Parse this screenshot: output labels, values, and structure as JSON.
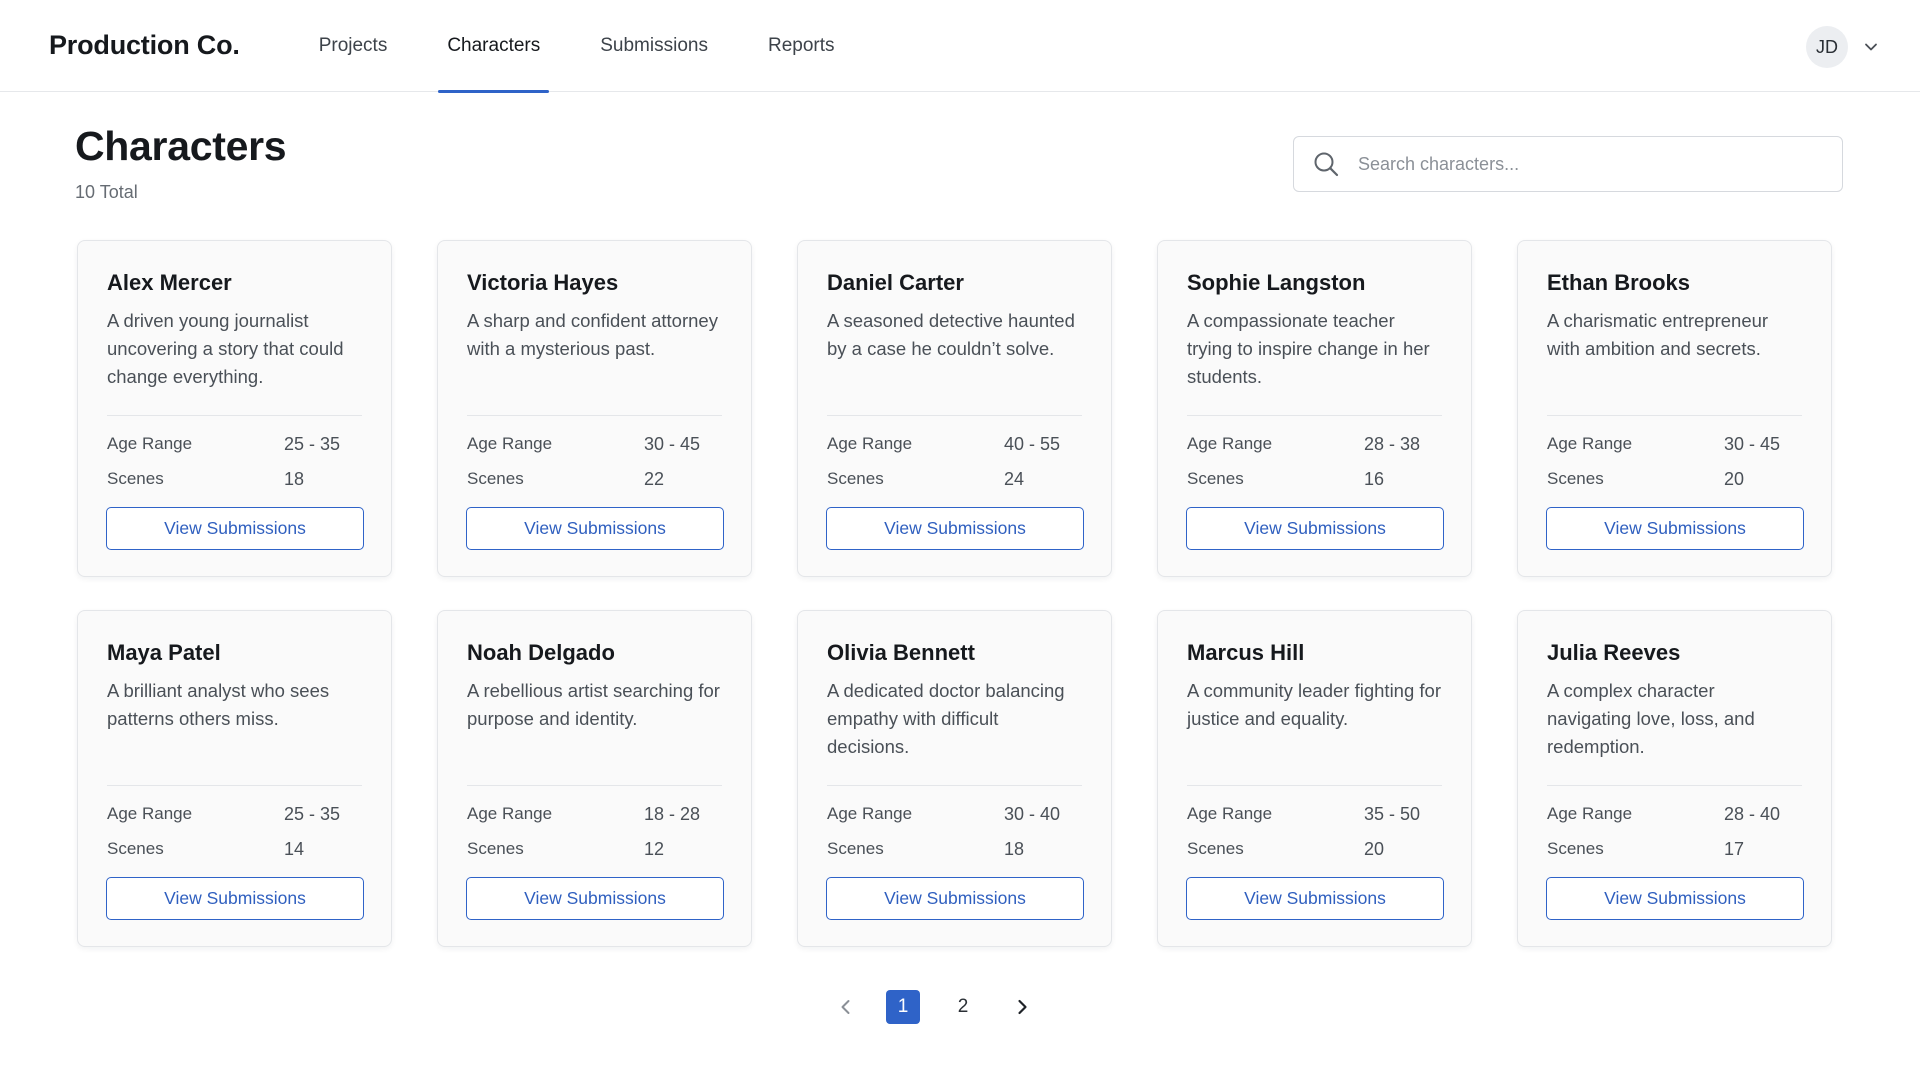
{
  "app": {
    "brand": "Production Co."
  },
  "nav": {
    "items": [
      {
        "label": "Projects",
        "active": false
      },
      {
        "label": "Characters",
        "active": true
      },
      {
        "label": "Submissions",
        "active": false
      },
      {
        "label": "Reports",
        "active": false
      }
    ]
  },
  "user": {
    "initials": "JD"
  },
  "page": {
    "title": "Characters",
    "count": "10 Total"
  },
  "search": {
    "placeholder": "Search characters...",
    "value": ""
  },
  "labels": {
    "age_range": "Age Range",
    "scenes": "Scenes",
    "view_button": "View Submissions"
  },
  "characters": [
    {
      "name": "Alex Mercer",
      "description": "A driven young journalist uncovering a story that could change everything.",
      "age_range": "25 - 35",
      "scenes": "18"
    },
    {
      "name": "Victoria Hayes",
      "description": "A sharp and confident attorney with a mysterious past.",
      "age_range": "30 - 45",
      "scenes": "22"
    },
    {
      "name": "Daniel Carter",
      "description": "A seasoned detective haunted by a case he couldn’t solve.",
      "age_range": "40 - 55",
      "scenes": "24"
    },
    {
      "name": "Sophie Langston",
      "description": "A compassionate teacher trying to inspire change in her students.",
      "age_range": "28 - 38",
      "scenes": "16"
    },
    {
      "name": "Ethan Brooks",
      "description": "A charismatic entrepreneur with ambition and secrets.",
      "age_range": "30 - 45",
      "scenes": "20"
    },
    {
      "name": "Maya Patel",
      "description": "A brilliant analyst who sees patterns others miss.",
      "age_range": "25 - 35",
      "scenes": "14"
    },
    {
      "name": "Noah Delgado",
      "description": "A rebellious artist searching for purpose and identity.",
      "age_range": "18 - 28",
      "scenes": "12"
    },
    {
      "name": "Olivia Bennett",
      "description": "A dedicated doctor balancing empathy with difficult decisions.",
      "age_range": "30 - 40",
      "scenes": "18"
    },
    {
      "name": "Marcus Hill",
      "description": "A community leader fighting for justice and equality.",
      "age_range": "35 - 50",
      "scenes": "20"
    },
    {
      "name": "Julia Reeves",
      "description": "A complex character navigating love, loss, and redemption.",
      "age_range": "28 - 40",
      "scenes": "17"
    }
  ],
  "pagination": {
    "pages": [
      "1",
      "2"
    ],
    "current": "1"
  },
  "colors": {
    "accent": "#2f63c8",
    "card_background": "#fafafa",
    "border": "#e4e6e9"
  }
}
